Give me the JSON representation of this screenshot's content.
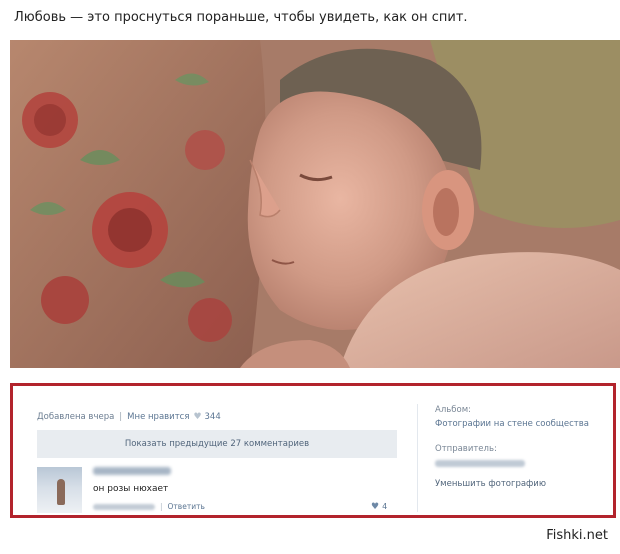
{
  "caption": "Любовь — это проснуться пораньше, чтобы увидеть, как он спит.",
  "post": {
    "added": "Добавлена вчера",
    "like_label": "Мне нравится",
    "like_count": "344",
    "show_previous": "Показать предыдущие 27 комментариев"
  },
  "comment": {
    "text": "он розы нюхает",
    "time": "сегодня в 1:06",
    "reply": "Ответить",
    "likes": "4"
  },
  "sidebar": {
    "album_label": "Альбом:",
    "album_link": "Фотографии на стене сообщества",
    "sender_label": "Отправитель:",
    "shrink_action": "Уменьшить фотографию"
  },
  "watermark": "Fishki.net",
  "colors": {
    "highlight_border": "#b2232c",
    "link": "#5b7592"
  },
  "icons": [
    "heart-icon"
  ]
}
